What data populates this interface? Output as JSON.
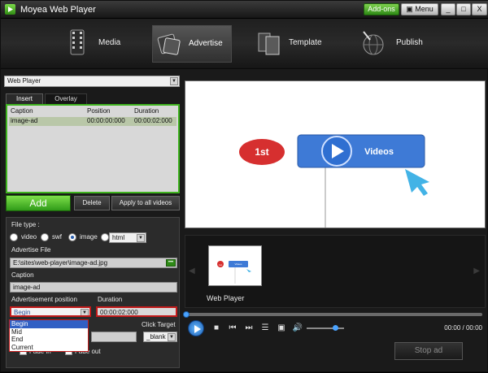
{
  "window": {
    "title": "Moyea Web Player"
  },
  "titlebar": {
    "addons": "Add-ons",
    "menu": "Menu",
    "minimize": "_",
    "maximize": "□",
    "close": "X"
  },
  "nav": [
    {
      "label": "Media",
      "icon": "film-icon"
    },
    {
      "label": "Advertise",
      "icon": "advertise-icon"
    },
    {
      "label": "Template",
      "icon": "template-icon"
    },
    {
      "label": "Publish",
      "icon": "publish-icon"
    }
  ],
  "player_select": {
    "value": "Web Player"
  },
  "tabs": {
    "insert": "Insert",
    "overlay": "Overlay"
  },
  "ad_list": {
    "headers": [
      "Caption",
      "Position",
      "Duration"
    ],
    "rows": [
      [
        "image-ad",
        "00:00:00:000",
        "00:00:02:000"
      ]
    ]
  },
  "actions": {
    "add": "Add",
    "delete": "Delete",
    "apply_all": "Apply to all videos"
  },
  "props": {
    "file_type_label": "File type :",
    "types": [
      "video",
      "swf",
      "image",
      "html"
    ],
    "selected_type": "image",
    "html_select": "html",
    "advertise_file_label": "Advertise File",
    "advertise_file": "E:\\sites\\web-player\\image-ad.jpg",
    "caption_label": "Caption",
    "caption": "image-ad",
    "ad_position_label": "Advertisement position",
    "ad_position": "Begin",
    "duration_label": "Duration",
    "duration": "00:00:02:000",
    "click_target_label": "Click Target",
    "click_target": "_blank",
    "fade_in": "Fade in",
    "fade_out": "Fade out",
    "position_options": [
      "Begin",
      "Mid",
      "End",
      "Current"
    ]
  },
  "preview": {
    "badge": "1st",
    "video_button": "Videos"
  },
  "thumbnail": {
    "label": "Web Player",
    "badge": "1st",
    "button": "Videos"
  },
  "player": {
    "time": "00:00 / 00:00",
    "progress": 0.0,
    "volume": 0.75
  },
  "stop_ad": "Stop ad",
  "colors": {
    "accent_green": "#3fb31f",
    "highlight_red": "#c21a1a",
    "play_blue": "#1b5fb5"
  }
}
